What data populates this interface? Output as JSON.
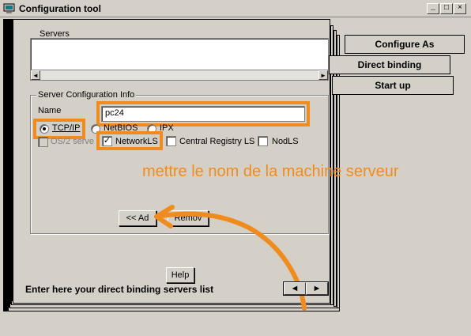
{
  "window": {
    "title": "Configuration tool",
    "minimize_glyph": "_",
    "maximize_glyph": "□",
    "close_glyph": "×"
  },
  "servers": {
    "label": "Servers",
    "scroll_left": "◄",
    "scroll_right": "►"
  },
  "server_config": {
    "group_label": "Server Configuration Info",
    "name_label": "Name",
    "name_value": "pc24",
    "protocols": [
      {
        "label": "TCP/IP",
        "selected": true
      },
      {
        "label": "NetBIOS",
        "selected": false
      },
      {
        "label": "IPX",
        "selected": false
      }
    ],
    "os2_label": "OS/2 serve",
    "checks": [
      {
        "label": "NetworkLS",
        "checked": true
      },
      {
        "label": "Central Registry LS",
        "checked": false
      },
      {
        "label": "NodLS",
        "checked": false
      }
    ],
    "add_button": "<< Ad",
    "remove_button": "Remov"
  },
  "tabs": [
    {
      "label": "Configure As"
    },
    {
      "label": "Direct binding"
    },
    {
      "label": "Start up"
    }
  ],
  "help_button": "Help",
  "status_text": "Enter here your direct binding servers list",
  "nav": {
    "prev": "◄",
    "next": "►"
  },
  "annotation": {
    "text": "mettre le nom de la machine serveur",
    "color": "#f08b1e"
  }
}
